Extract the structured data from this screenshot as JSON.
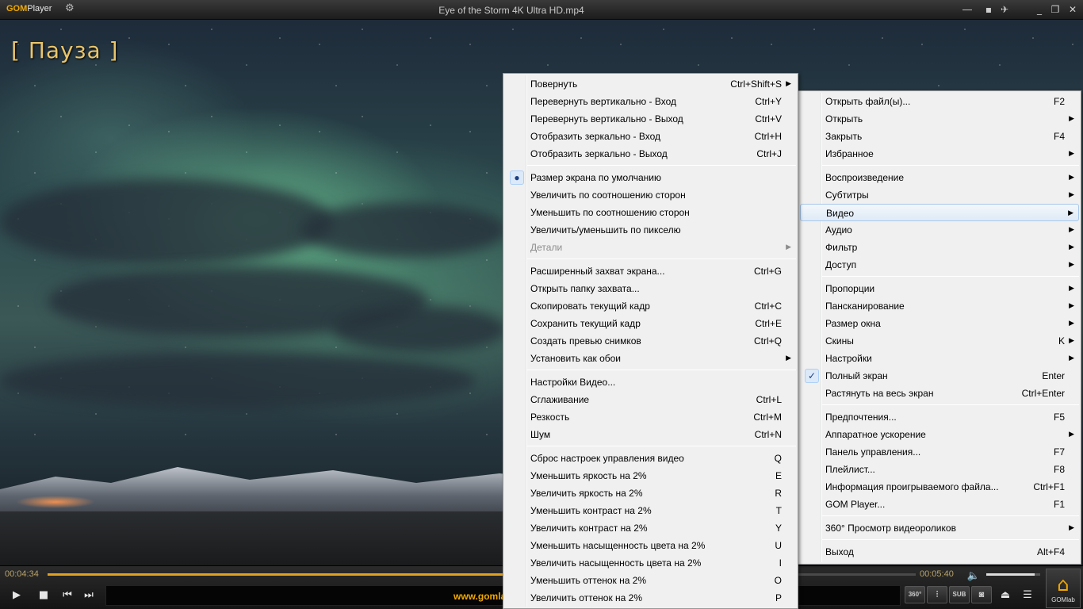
{
  "titlebar": {
    "logo_gom": "GOM",
    "logo_player": "Player",
    "title": "Eye of the Storm 4K Ultra HD.mp4"
  },
  "overlay": {
    "pause": "[ Пауза ]"
  },
  "controls": {
    "time_current": "00:04:34",
    "time_total": "00:05:40",
    "progress": 0.806,
    "volume": 0.9,
    "ticker": "www.gomla",
    "gomlab_label": "GOMlab",
    "tool_360": "360°",
    "tool_sub": "SUB"
  },
  "main_menu": [
    {
      "label": "Открыть файл(ы)...",
      "shortcut": "F2"
    },
    {
      "label": "Открыть",
      "submenu": true
    },
    {
      "label": "Закрыть",
      "shortcut": "F4"
    },
    {
      "label": "Избранное",
      "submenu": true
    },
    {
      "separator": true
    },
    {
      "label": "Воспроизведение",
      "submenu": true
    },
    {
      "label": "Субтитры",
      "submenu": true
    },
    {
      "label": "Видео",
      "submenu": true,
      "highlighted": true
    },
    {
      "label": "Аудио",
      "submenu": true
    },
    {
      "label": "Фильтр",
      "submenu": true
    },
    {
      "label": "Доступ",
      "submenu": true
    },
    {
      "separator": true
    },
    {
      "label": "Пропорции",
      "submenu": true
    },
    {
      "label": "Пансканирование",
      "submenu": true
    },
    {
      "label": "Размер окна",
      "submenu": true
    },
    {
      "label": "Скины",
      "shortcut": "K",
      "submenu": true
    },
    {
      "label": "Настройки",
      "submenu": true
    },
    {
      "label": "Полный экран",
      "shortcut": "Enter",
      "checked": true
    },
    {
      "label": "Растянуть на весь экран",
      "shortcut": "Ctrl+Enter"
    },
    {
      "separator": true
    },
    {
      "label": "Предпочтения...",
      "shortcut": "F5"
    },
    {
      "label": "Аппаратное ускорение",
      "submenu": true
    },
    {
      "label": "Панель управления...",
      "shortcut": "F7"
    },
    {
      "label": "Плейлист...",
      "shortcut": "F8"
    },
    {
      "label": "Информация проигрываемого файла...",
      "shortcut": "Ctrl+F1"
    },
    {
      "label": "GOM Player...",
      "shortcut": "F1"
    },
    {
      "separator": true
    },
    {
      "label": "360° Просмотр видеороликов",
      "submenu": true
    },
    {
      "separator": true
    },
    {
      "label": "Выход",
      "shortcut": "Alt+F4"
    }
  ],
  "video_menu": [
    {
      "label": "Повернуть",
      "shortcut": "Ctrl+Shift+S",
      "submenu": true
    },
    {
      "label": "Перевернуть вертикально - Вход",
      "shortcut": "Ctrl+Y"
    },
    {
      "label": "Перевернуть вертикально - Выход",
      "shortcut": "Ctrl+V"
    },
    {
      "label": "Отобразить зеркально - Вход",
      "shortcut": "Ctrl+H"
    },
    {
      "label": "Отобразить зеркально - Выход",
      "shortcut": "Ctrl+J"
    },
    {
      "separator": true
    },
    {
      "label": "Размер экрана по умолчанию",
      "radio": true
    },
    {
      "label": "Увеличить по соотношению сторон"
    },
    {
      "label": "Уменьшить по соотношению сторон"
    },
    {
      "label": "Увеличить/уменьшить по пикселю"
    },
    {
      "label": "Детали",
      "submenu": true,
      "disabled": true
    },
    {
      "separator": true
    },
    {
      "label": "Расширенный захват экрана...",
      "shortcut": "Ctrl+G"
    },
    {
      "label": "Открыть папку захвата..."
    },
    {
      "label": "Скопировать текущий кадр",
      "shortcut": "Ctrl+C"
    },
    {
      "label": "Сохранить текущий кадр",
      "shortcut": "Ctrl+E"
    },
    {
      "label": "Создать превью снимков",
      "shortcut": "Ctrl+Q"
    },
    {
      "label": "Установить как обои",
      "submenu": true
    },
    {
      "separator": true
    },
    {
      "label": "Настройки Видео..."
    },
    {
      "label": "Сглаживание",
      "shortcut": "Ctrl+L"
    },
    {
      "label": "Резкость",
      "shortcut": "Ctrl+M"
    },
    {
      "label": "Шум",
      "shortcut": "Ctrl+N"
    },
    {
      "separator": true
    },
    {
      "label": "Сброс настроек управления видео",
      "shortcut": "Q"
    },
    {
      "label": "Уменьшить яркость на 2%",
      "shortcut": "E"
    },
    {
      "label": "Увеличить яркость на 2%",
      "shortcut": "R"
    },
    {
      "label": "Уменьшить контраст на 2%",
      "shortcut": "T"
    },
    {
      "label": "Увеличить контраст на 2%",
      "shortcut": "Y"
    },
    {
      "label": "Уменьшить насыщенность цвета на 2%",
      "shortcut": "U"
    },
    {
      "label": "Увеличить насыщенность цвета на 2%",
      "shortcut": "I"
    },
    {
      "label": "Уменьшить оттенок на 2%",
      "shortcut": "O"
    },
    {
      "label": "Увеличить оттенок на 2%",
      "shortcut": "P"
    }
  ],
  "icons": {
    "settings": "gear-icon",
    "minimize": "minimize-icon",
    "pin": "pin-icon",
    "play": "play-icon",
    "stop": "stop-icon",
    "prev": "prev-icon",
    "next": "next-icon",
    "volume": "speaker-icon",
    "eject": "eject-icon",
    "playlist": "menu-icon",
    "home": "home-icon"
  },
  "colors": {
    "accent": "#f2a900",
    "menu_bg": "#f0f0f0",
    "highlight": "#dfeaf7"
  }
}
